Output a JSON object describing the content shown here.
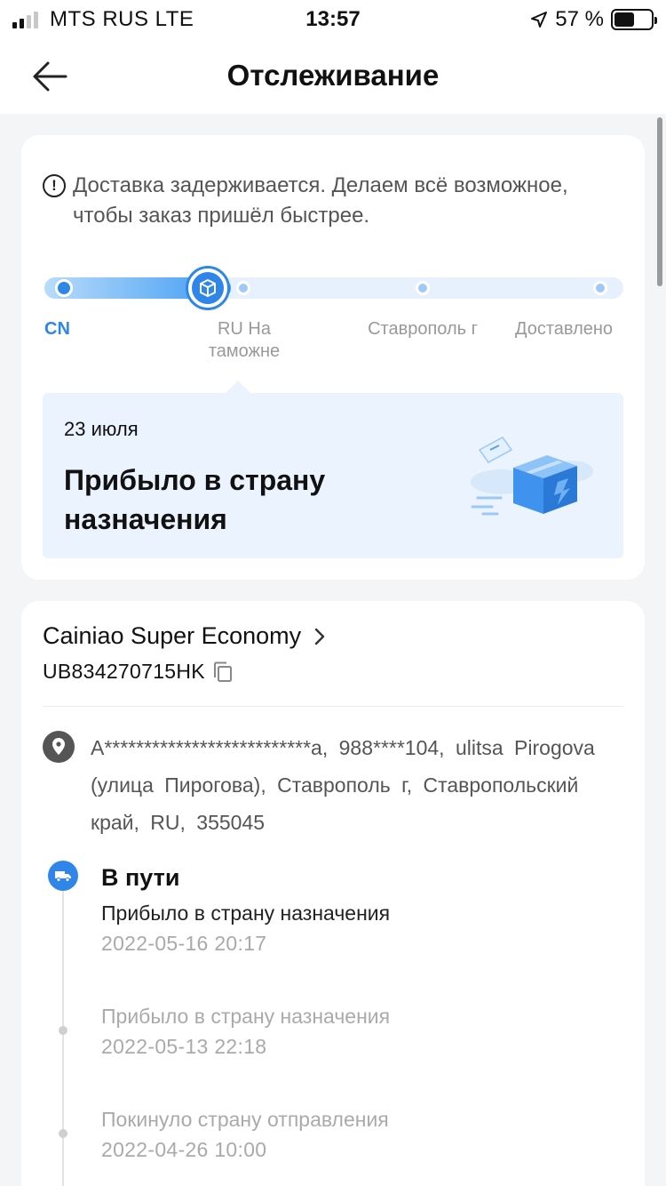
{
  "status_bar": {
    "carrier": "MTS RUS  LTE",
    "time": "13:57",
    "battery": "57 %"
  },
  "header": {
    "title": "Отслеживание"
  },
  "notice": {
    "text": "Доставка задерживается. Делаем всё возможное, чтобы заказ пришёл быстрее."
  },
  "progress": {
    "steps": [
      {
        "label": "CN"
      },
      {
        "label": "RU На таможне"
      },
      {
        "label": "Ставрополь г"
      },
      {
        "label": "Доставлено"
      }
    ],
    "current_step": 1
  },
  "current_event": {
    "date": "23 июля",
    "title": "Прибыло в страну назначения"
  },
  "shipment": {
    "carrier": "Cainiao Super Economy",
    "tracking_number": "UB834270715HK",
    "address": "A**************************a,  988****104,  ulitsa Pirogova (улица Пирогова),  Ставрополь г,  Ставропольский край,  RU,  355045"
  },
  "timeline": {
    "current_status": "В пути",
    "events": [
      {
        "text": "Прибыло в страну назначения",
        "time": "2022-05-16 20:17"
      },
      {
        "text": "Прибыло в страну назначения",
        "time": "2022-05-13 22:18"
      },
      {
        "text": "Покинуло страну отправления",
        "time": "2022-04-26 10:00"
      }
    ]
  },
  "colors": {
    "accent": "#2f86e8",
    "background": "#f4f5f7",
    "event_bg": "#eaf3fe"
  }
}
